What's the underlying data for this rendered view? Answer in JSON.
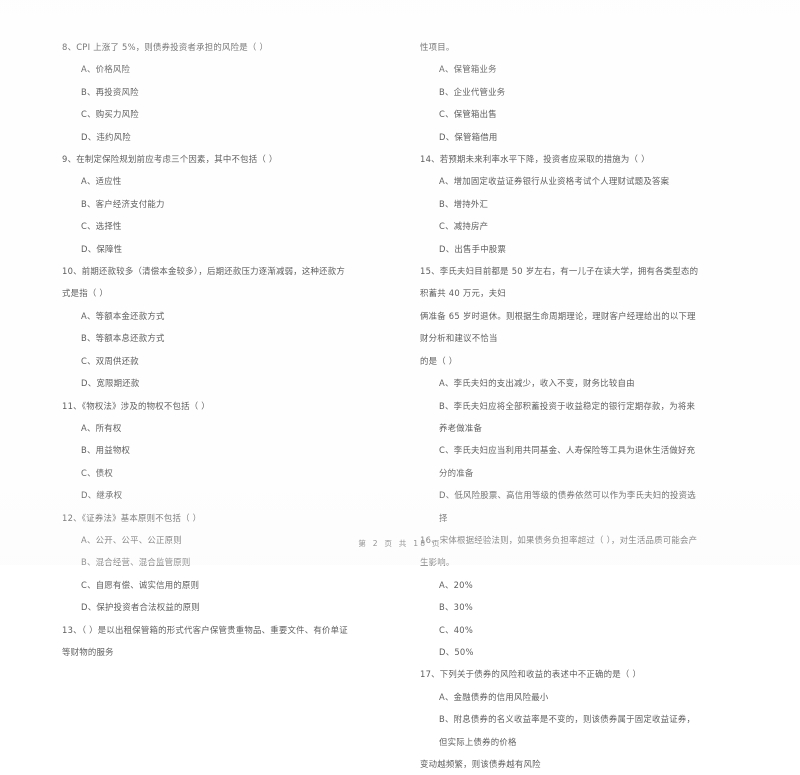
{
  "document": {
    "type": "scanned-exam-paper",
    "subject_hint": "银行从业资格考试 个人理财试题及答案",
    "ink_color": "#5d5d5d",
    "page_background": "#fefefe"
  },
  "footer": {
    "page_label": "第 2 页 共 18 页",
    "current_page": "2",
    "total_pages": "18"
  },
  "left_column": {
    "questions": [
      {
        "number": "8",
        "stem": "8、CPI 上涨了 5%，则债券投资者承担的风险是（      ）",
        "options": [
          "A、价格风险",
          "B、再投资风险",
          "C、购买力风险",
          "D、违约风险"
        ]
      },
      {
        "number": "9",
        "stem": "9、在制定保险规划前应考虑三个因素，其中不包括（      ）",
        "options": [
          "A、适应性",
          "B、客户经济支付能力",
          "C、选择性",
          "D、保障性"
        ]
      },
      {
        "number": "10",
        "stem": "10、前期还款较多（清偿本金较多），后期还款压力逐渐减弱，这种还款方式是指（      ）",
        "options": [
          "A、等额本金还款方式",
          "B、等额本息还款方式",
          "C、双周供还款",
          "D、宽限期还款"
        ]
      },
      {
        "number": "11",
        "stem": "11、《物权法》涉及的物权不包括（      ）",
        "options": [
          "A、所有权",
          "B、用益物权",
          "C、债权",
          "D、继承权"
        ]
      },
      {
        "number": "12",
        "stem": "12、《证券法》基本原则不包括（      ）",
        "options": [
          "A、公开、公平、公正原则",
          "B、混合经营、混合监管原则",
          "C、自愿有偿、诚实信用的原则",
          "D、保护投资者合法权益的原则"
        ]
      },
      {
        "number": "13",
        "stem": "13、（      ）是以出租保管箱的形式代客户保管贵重物品、重要文件、有价单证等财物的服务",
        "options": []
      }
    ]
  },
  "right_column": {
    "lead_fragment": "性项目。",
    "questions": [
      {
        "number": "13-options",
        "stem": "",
        "options": [
          "A、保管箱业务",
          "B、企业代管业务",
          "C、保管箱出售",
          "D、保管箱借用"
        ]
      },
      {
        "number": "14",
        "stem": "14、若预期未来利率水平下降，投资者应采取的措施为（      ）",
        "options": [
          "A、增加固定收益证券银行从业资格考试个人理财试题及答案",
          "B、增持外汇",
          "C、减持房产",
          "D、出售手中股票"
        ]
      },
      {
        "number": "15",
        "stem_line1": "15、李氏夫妇目前都是 50 岁左右，有一儿子在读大学，拥有各类型态的积蓄共 40 万元，夫妇",
        "stem_line2": "俩准备 65 岁时退休。则根据生命周期理论，理财客户经理给出的以下理财分析和建议不恰当",
        "stem_line3": "的是（      ）",
        "options": [
          "A、李氏夫妇的支出减少，收入不变，财务比较自由",
          "B、李氏夫妇应将全部积蓄投资于收益稳定的银行定期存款，为将来养老做准备",
          "C、李氏夫妇应当利用共同基金、人寿保险等工具为退休生活做好充分的准备",
          "D、低风险股票、高信用等级的债券依然可以作为李氏夫妇的投资选择"
        ]
      },
      {
        "number": "16",
        "stem": "16、宋体根据经验法则，如果债务负担率超过（      ），对生活品质可能会产生影响。",
        "options": [
          "A、20%",
          "B、30%",
          "C、40%",
          "D、50%"
        ]
      },
      {
        "number": "17",
        "stem": "17、下列关于债券的风险和收益的表述中不正确的是（      ）",
        "options": [
          "A、金融债券的信用风险最小"
        ],
        "option_b_line1": "B、附息债券的名义收益率是不变的，则该债券属于固定收益证券，但实际上债券的价格",
        "option_b_line2": "变动越频繁，则该债券越有风险"
      }
    ]
  }
}
